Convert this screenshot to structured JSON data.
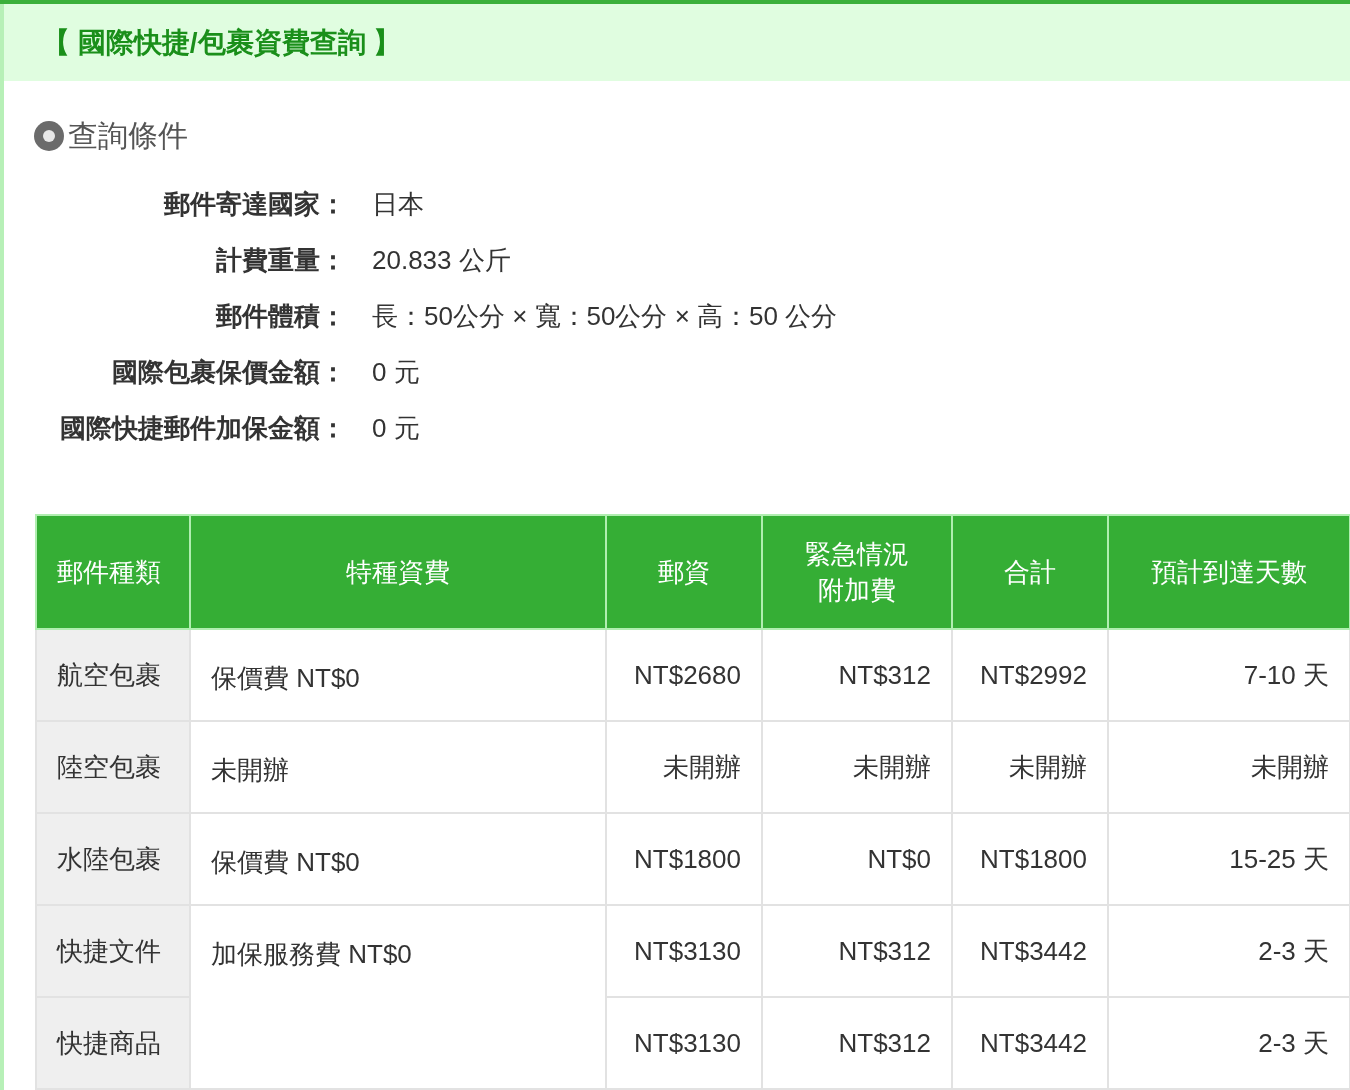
{
  "title": "【 國際快捷/包裹資費查詢 】",
  "section": {
    "heading": "查詢條件"
  },
  "conditions": [
    {
      "label": "郵件寄達國家：",
      "value": "日本"
    },
    {
      "label": "計費重量：",
      "value": "20.833 公斤"
    },
    {
      "label": "郵件體積：",
      "value": "長：50公分 × 寬：50公分 × 高：50 公分"
    },
    {
      "label": "國際包裹保價金額：",
      "value": "0 元"
    },
    {
      "label": "國際快捷郵件加保金額：",
      "value": "0 元"
    }
  ],
  "table": {
    "columns": [
      "郵件種類",
      "特種資費",
      "郵資",
      "緊急情況附加費",
      "合計",
      "預計到達天數"
    ],
    "groups": [
      {
        "special": "保價費 NT$0",
        "rows": [
          {
            "type": "航空包裹",
            "postage": "NT$2680",
            "surcharge": "NT$312",
            "total": "NT$2992",
            "days": "7-10 天"
          }
        ]
      },
      {
        "special": "未開辦",
        "rows": [
          {
            "type": "陸空包裹",
            "postage": "未開辦",
            "surcharge": "未開辦",
            "total": "未開辦",
            "days": "未開辦"
          }
        ]
      },
      {
        "special": "保價費 NT$0",
        "rows": [
          {
            "type": "水陸包裹",
            "postage": "NT$1800",
            "surcharge": "NT$0",
            "total": "NT$1800",
            "days": "15-25 天"
          }
        ]
      },
      {
        "special": "加保服務費 NT$0",
        "rows": [
          {
            "type": "快捷文件",
            "postage": "NT$3130",
            "surcharge": "NT$312",
            "total": "NT$3442",
            "days": "2-3 天"
          },
          {
            "type": "快捷商品",
            "postage": "NT$3130",
            "surcharge": "NT$312",
            "total": "NT$3442",
            "days": "2-3 天"
          }
        ]
      }
    ]
  }
}
